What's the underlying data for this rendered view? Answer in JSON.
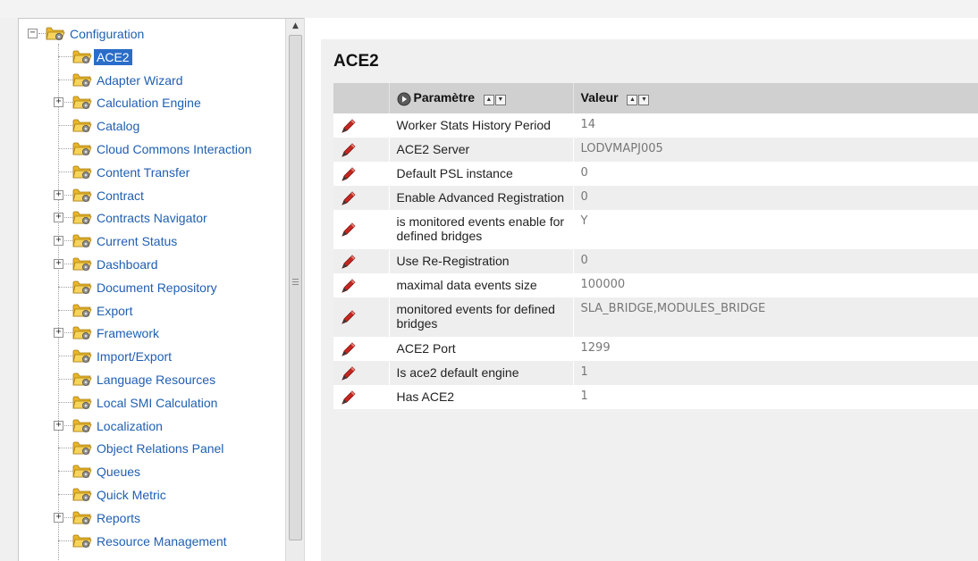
{
  "tree": {
    "items": [
      {
        "label": "Configuration",
        "level": 0,
        "expander": "−",
        "selected": false
      },
      {
        "label": "ACE2",
        "level": 1,
        "expander": "",
        "selected": true
      },
      {
        "label": "Adapter Wizard",
        "level": 1,
        "expander": "",
        "selected": false
      },
      {
        "label": "Calculation Engine",
        "level": 1,
        "expander": "+",
        "selected": false
      },
      {
        "label": "Catalog",
        "level": 1,
        "expander": "",
        "selected": false
      },
      {
        "label": "Cloud Commons Interaction",
        "level": 1,
        "expander": "",
        "selected": false
      },
      {
        "label": "Content Transfer",
        "level": 1,
        "expander": "",
        "selected": false
      },
      {
        "label": "Contract",
        "level": 1,
        "expander": "+",
        "selected": false
      },
      {
        "label": "Contracts Navigator",
        "level": 1,
        "expander": "+",
        "selected": false
      },
      {
        "label": "Current Status",
        "level": 1,
        "expander": "+",
        "selected": false
      },
      {
        "label": "Dashboard",
        "level": 1,
        "expander": "+",
        "selected": false
      },
      {
        "label": "Document Repository",
        "level": 1,
        "expander": "",
        "selected": false
      },
      {
        "label": "Export",
        "level": 1,
        "expander": "",
        "selected": false
      },
      {
        "label": "Framework",
        "level": 1,
        "expander": "+",
        "selected": false
      },
      {
        "label": "Import/Export",
        "level": 1,
        "expander": "",
        "selected": false
      },
      {
        "label": "Language Resources",
        "level": 1,
        "expander": "",
        "selected": false
      },
      {
        "label": "Local SMI Calculation",
        "level": 1,
        "expander": "",
        "selected": false
      },
      {
        "label": "Localization",
        "level": 1,
        "expander": "+",
        "selected": false
      },
      {
        "label": "Object Relations Panel",
        "level": 1,
        "expander": "",
        "selected": false
      },
      {
        "label": "Queues",
        "level": 1,
        "expander": "",
        "selected": false
      },
      {
        "label": "Quick Metric",
        "level": 1,
        "expander": "",
        "selected": false
      },
      {
        "label": "Reports",
        "level": 1,
        "expander": "+",
        "selected": false
      },
      {
        "label": "Resource Management",
        "level": 1,
        "expander": "",
        "selected": false
      }
    ],
    "folder_icon": "gear-folder-icon",
    "scroll_up_glyph": "▲"
  },
  "main": {
    "title": "ACE2",
    "columns": {
      "param": "Paramètre",
      "value": "Valeur",
      "sort_up": "▲",
      "sort_down": "▼"
    },
    "rows": [
      {
        "param": "Worker Stats History Period",
        "value": "14"
      },
      {
        "param": "ACE2 Server",
        "value": "LODVMAPJ005"
      },
      {
        "param": "Default PSL instance",
        "value": "0"
      },
      {
        "param": "Enable Advanced Registration",
        "value": "0"
      },
      {
        "param": "is monitored events enable for defined bridges",
        "value": "Y"
      },
      {
        "param": "Use Re-Registration",
        "value": "0"
      },
      {
        "param": "maximal data events size",
        "value": "100000"
      },
      {
        "param": "monitored events for defined bridges",
        "value": "SLA_BRIDGE,MODULES_BRIDGE"
      },
      {
        "param": "ACE2 Port",
        "value": "1299"
      },
      {
        "param": "Is ace2 default engine",
        "value": "1"
      },
      {
        "param": "Has ACE2",
        "value": "1"
      }
    ],
    "edit_icon": "pencil-icon"
  },
  "colors": {
    "link": "#1f5fb2",
    "selected_bg": "#2a6dc9",
    "header_bg": "#d0d0d0",
    "row_alt": "#eeeeee"
  }
}
